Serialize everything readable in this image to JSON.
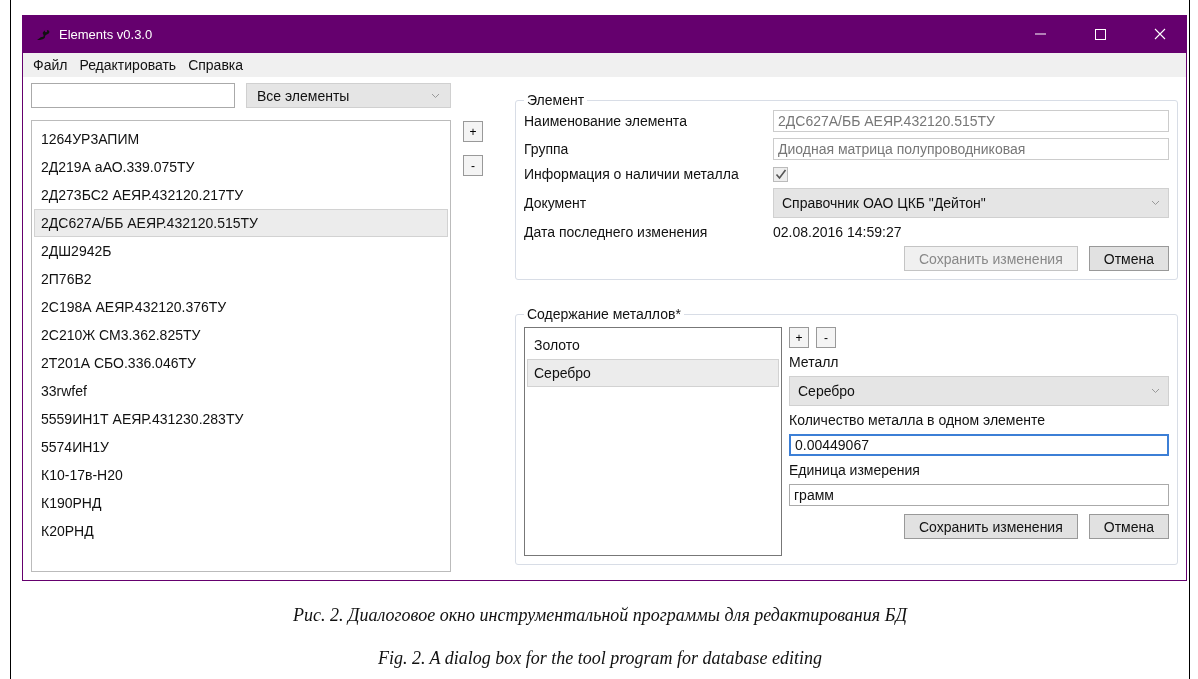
{
  "window": {
    "title": "Elements v0.3.0"
  },
  "menu": [
    "Файл",
    "Редактировать",
    "Справка"
  ],
  "filter": {
    "value": "Все элементы"
  },
  "elements": [
    {
      "label": "1264УР3АПИМ",
      "selected": false
    },
    {
      "label": "2Д219А аАО.339.075ТУ",
      "selected": false
    },
    {
      "label": "2Д273БС2 АЕЯР.432120.217ТУ",
      "selected": false
    },
    {
      "label": "2ДС627А/ББ АЕЯР.432120.515ТУ",
      "selected": true
    },
    {
      "label": "2ДШ2942Б",
      "selected": false
    },
    {
      "label": "2П76В2",
      "selected": false
    },
    {
      "label": "2С198А АЕЯР.432120.376ТУ",
      "selected": false
    },
    {
      "label": "2С210Ж СМ3.362.825ТУ",
      "selected": false
    },
    {
      "label": "2Т201А СБО.336.046ТУ",
      "selected": false
    },
    {
      "label": "33rwfef",
      "selected": false
    },
    {
      "label": "5559ИН1Т АЕЯР.431230.283ТУ",
      "selected": false
    },
    {
      "label": "5574ИН1У",
      "selected": false
    },
    {
      "label": "К10-17в-Н20",
      "selected": false
    },
    {
      "label": "К190РНД",
      "selected": false
    },
    {
      "label": "К20РНД",
      "selected": false
    }
  ],
  "list_buttons": [
    "+",
    "-"
  ],
  "element_group": {
    "title": "Элемент",
    "fields": [
      {
        "kind": "readonly",
        "label": "Наименование элемента",
        "value": "2ДС627А/ББ АЕЯР.432120.515ТУ"
      },
      {
        "kind": "readonly",
        "label": "Группа",
        "value": "Диодная матрица полупроводниковая"
      },
      {
        "kind": "checkbox",
        "label": "Информация о наличии металла",
        "checked": true
      },
      {
        "kind": "dropdown",
        "label": "Документ",
        "value": "Справочник ОАО ЦКБ \"Дейтон\""
      },
      {
        "kind": "static",
        "label": "Дата последнего изменения",
        "value": "02.08.2016 14:59:27"
      }
    ],
    "buttons": [
      {
        "label": "Сохранить изменения",
        "disabled": true
      },
      {
        "label": "Отмена",
        "disabled": false
      }
    ]
  },
  "metals_group": {
    "title": "Содержание металлов*",
    "items": [
      {
        "label": "Золото",
        "selected": false
      },
      {
        "label": "Серебро",
        "selected": true
      }
    ],
    "list_buttons": [
      "+",
      "-"
    ],
    "fields": [
      {
        "kind": "dropdown",
        "label": "Металл",
        "value": "Серебро",
        "focused": false
      },
      {
        "kind": "input",
        "label": "Количество металла в одном элементе",
        "value": "0.00449067",
        "focused": true
      },
      {
        "kind": "input",
        "label": "Единица измерения",
        "value": "грамм",
        "focused": false
      }
    ],
    "buttons": [
      {
        "label": "Сохранить изменения",
        "disabled": false
      },
      {
        "label": "Отмена",
        "disabled": false
      }
    ]
  },
  "captions": [
    "Рис. 2. Диалоговое окно инструментальной программы для редактирования БД",
    "Fig. 2. A dialog box for the tool program for database editing"
  ]
}
